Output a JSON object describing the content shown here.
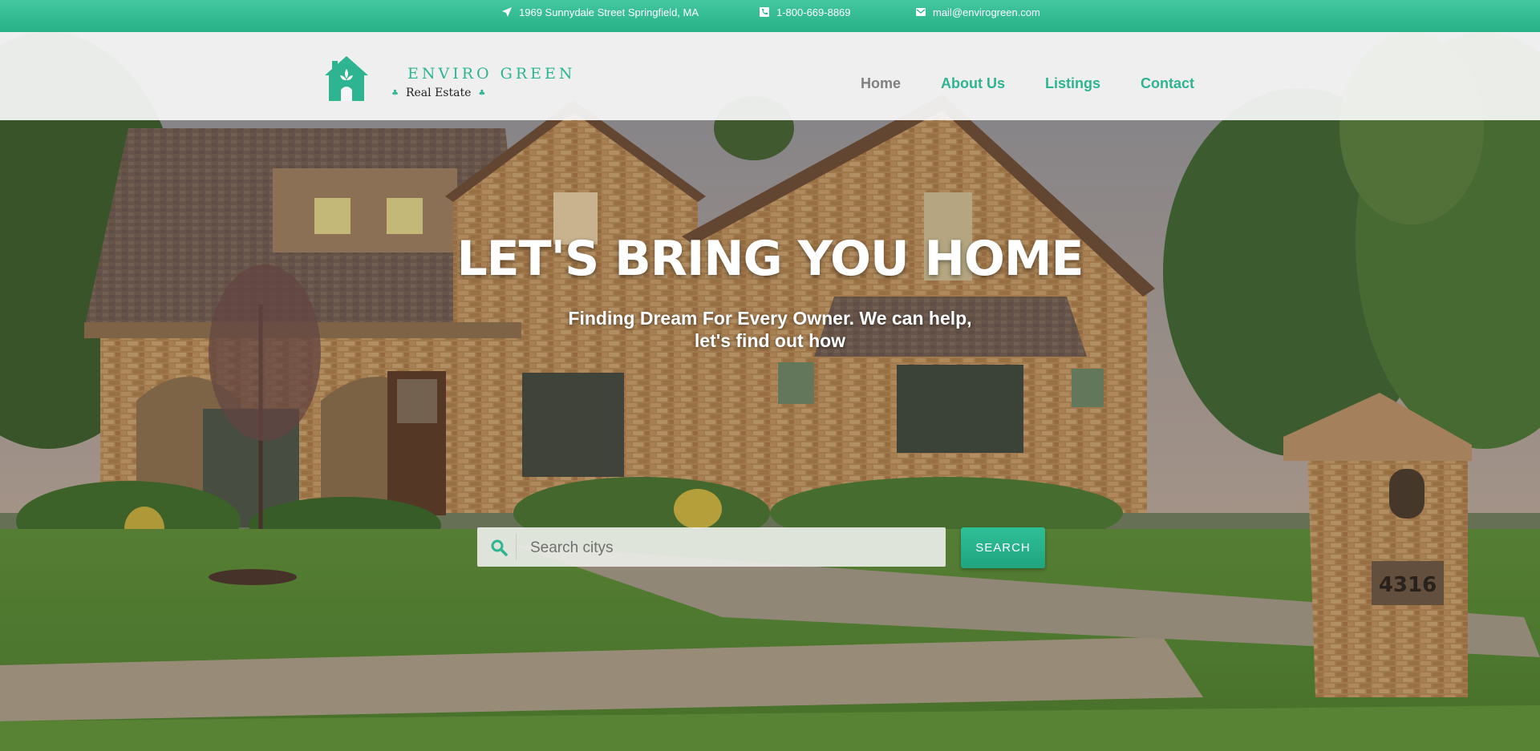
{
  "topbar": {
    "address": "1969 Sunnydale Street Springfield, MA",
    "address_icon": "location-arrow-icon",
    "phone": "1-800-669-8869",
    "phone_icon": "phone-icon",
    "email": "mail@envirogreen.com",
    "email_icon": "envelope-icon",
    "color": "#2eb48f"
  },
  "logo": {
    "brand": "ENVIRO GREEN",
    "subtitle": "Real Estate",
    "accent_color": "#2eb491"
  },
  "nav": {
    "items": [
      {
        "label": "Home",
        "active": true
      },
      {
        "label": "About Us",
        "active": false
      },
      {
        "label": "Listings",
        "active": false
      },
      {
        "label": "Contact",
        "active": false
      }
    ]
  },
  "hero": {
    "headline": "LET'S BRING YOU HOME",
    "subline_1": "Finding Dream For Every Owner. We can help,",
    "subline_2": "let's find out how",
    "mailbox_number": "4316"
  },
  "search": {
    "placeholder": "Search citys",
    "value": "",
    "icon": "search-icon",
    "button_label": "SEARCH"
  }
}
